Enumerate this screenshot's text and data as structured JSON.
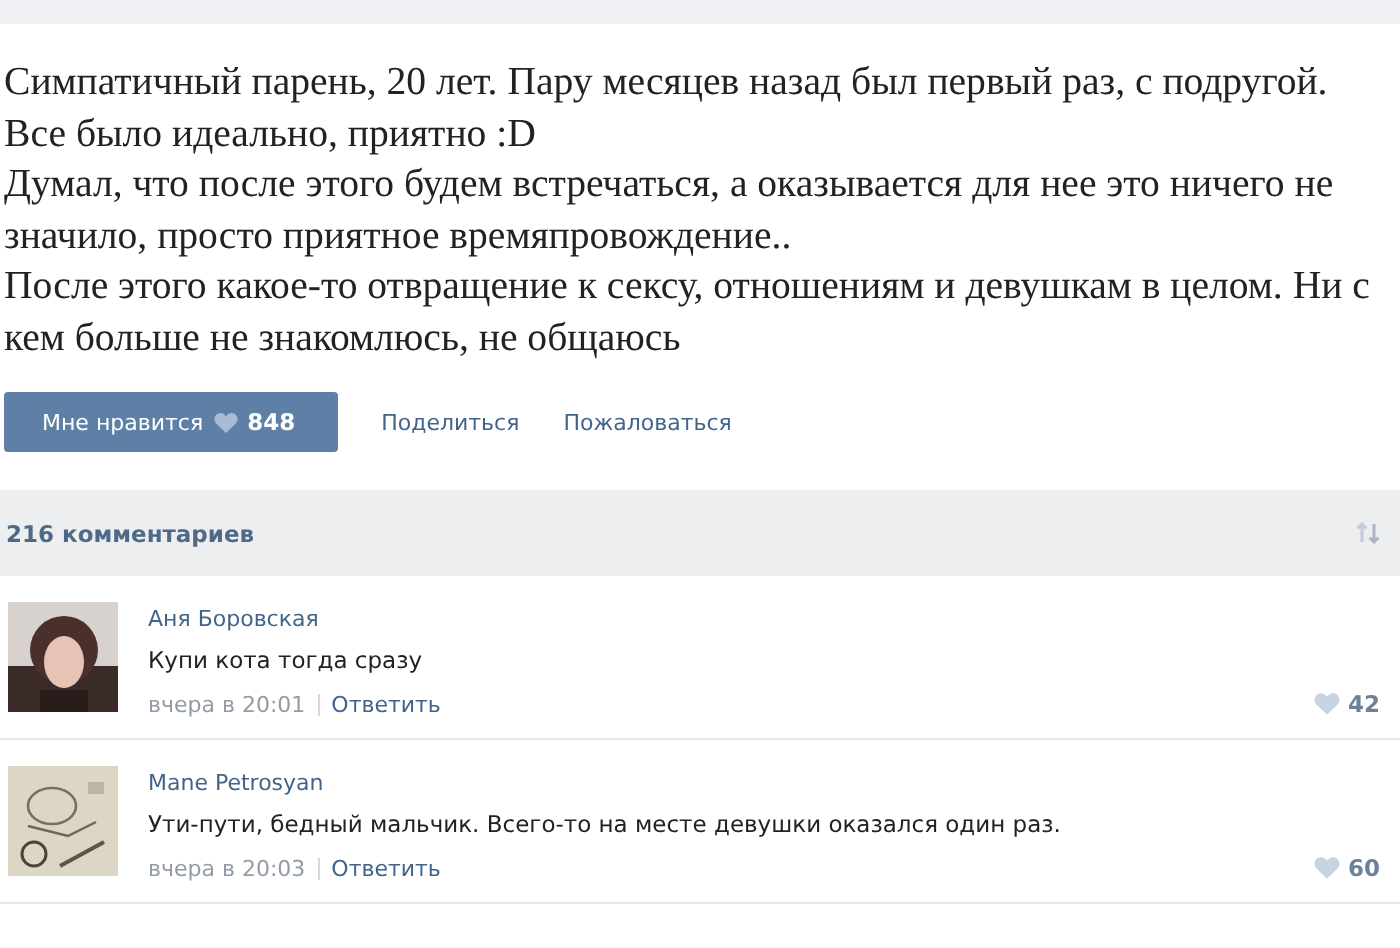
{
  "post": {
    "paragraphs": [
      "Симпатичный парень, 20 лет. Пару месяцев назад был первый раз, с подругой. Все было идеально, приятно :D",
      "Думал, что после этого будем встречаться, а оказывается для нее это ничего не значило, просто приятное времяпровождение..",
      "После этого какое-то отвращение к сексу, отношениям и девушкам в целом. Ни с кем больше не знакомлюсь, не общаюсь"
    ]
  },
  "actions": {
    "like": {
      "label": "Мне нравится",
      "count": "848"
    },
    "links": [
      "Поделиться",
      "Пожаловаться"
    ]
  },
  "comments_header": {
    "count": "216 комментариев"
  },
  "comments": [
    {
      "author": "Аня Боровская",
      "text": "Купи кота тогда сразу",
      "time": "вчера в 20:01",
      "reply": "Ответить",
      "likes": "42"
    },
    {
      "author": "Mane Petrosyan",
      "text": "Ути-пути, бедный мальчик. Всего-то на месте девушки оказался один раз.",
      "time": "вчера в 20:03",
      "reply": "Ответить",
      "likes": "60"
    }
  ]
}
